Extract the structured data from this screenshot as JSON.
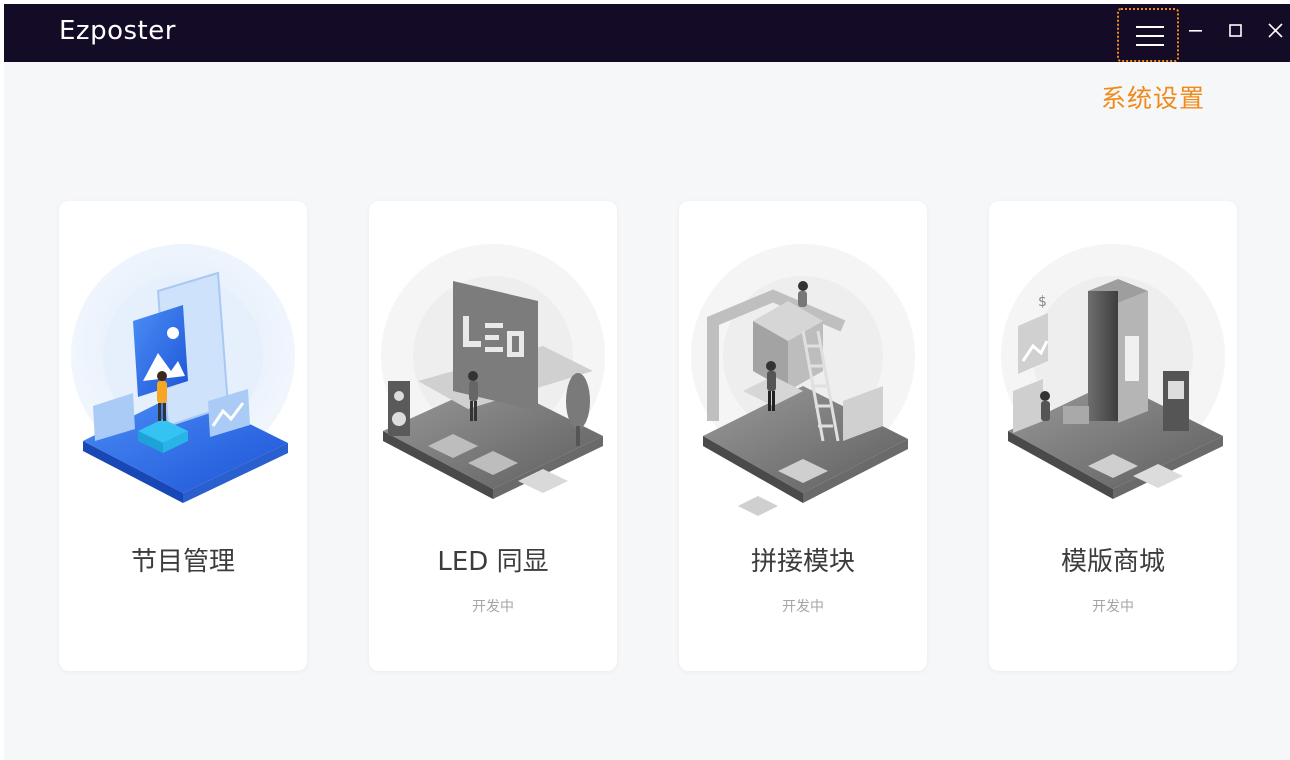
{
  "app": {
    "title": "Ezposter"
  },
  "window_controls": {
    "menu_icon": "hamburger-menu-icon",
    "minimize_icon": "minimize-icon",
    "maximize_icon": "maximize-icon",
    "close_icon": "close-icon"
  },
  "settings": {
    "label": "系统设置",
    "color": "#f08a1a"
  },
  "cards": [
    {
      "title": "节目管理",
      "subtitle": "",
      "illustration": "program-management-illustration",
      "accent": "#2f6fe8"
    },
    {
      "title": "LED 同显",
      "subtitle": "开发中",
      "illustration": "led-sync-illustration",
      "accent": "#8c8c8c"
    },
    {
      "title": "拼接模块",
      "subtitle": "开发中",
      "illustration": "splicing-module-illustration",
      "accent": "#8c8c8c"
    },
    {
      "title": "模版商城",
      "subtitle": "开发中",
      "illustration": "template-store-illustration",
      "accent": "#8c8c8c"
    }
  ],
  "colors": {
    "titlebar": "#140c26",
    "background": "#f6f7f9",
    "card": "#ffffff"
  }
}
